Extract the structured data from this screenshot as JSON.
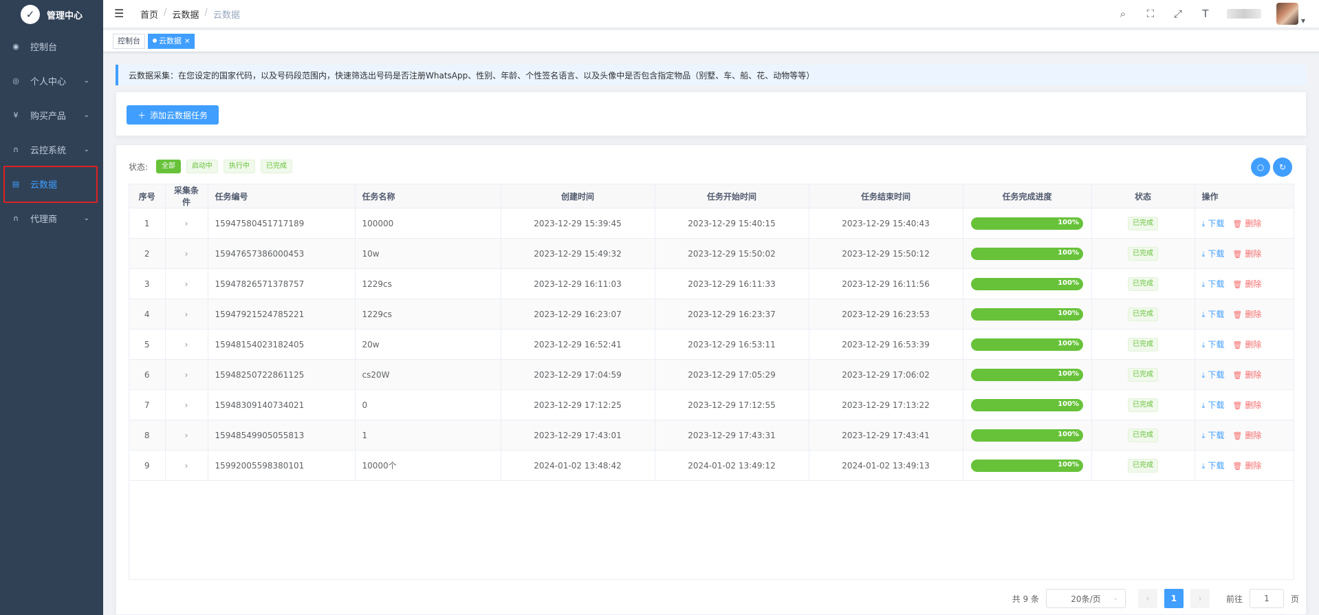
{
  "sidebar": {
    "logo_text": "管理中心",
    "items": [
      {
        "label": "控制台",
        "icon": "dashboard-icon",
        "glyph": "◉",
        "has_children": false,
        "active": false
      },
      {
        "label": "个人中心",
        "icon": "user-icon",
        "glyph": "◎",
        "has_children": true,
        "active": false
      },
      {
        "label": "购买产品",
        "icon": "yen-icon",
        "glyph": "¥",
        "has_children": true,
        "active": false
      },
      {
        "label": "云控系统",
        "icon": "headset-icon",
        "glyph": "∩",
        "has_children": true,
        "active": false
      },
      {
        "label": "云数据",
        "icon": "document-icon",
        "glyph": "▤",
        "has_children": false,
        "active": true
      },
      {
        "label": "代理商",
        "icon": "headset-icon",
        "glyph": "∩",
        "has_children": true,
        "active": false
      }
    ]
  },
  "header": {
    "breadcrumb": [
      "首页",
      "云数据",
      "云数据"
    ]
  },
  "tags": {
    "items": [
      {
        "label": "控制台",
        "active": false
      },
      {
        "label": "云数据",
        "active": true
      }
    ]
  },
  "alert": {
    "text": "云数据采集：在您设定的国家代码，以及号码段范围内，快速筛选出号码是否注册WhatsApp、性别、年龄、个性签名语言、以及头像中是否包含指定物品（别墅、车、船、花、动物等等）"
  },
  "toolbar": {
    "add_label": "添加云数据任务"
  },
  "filter": {
    "label": "状态:",
    "options": [
      "全部",
      "启动中",
      "执行中",
      "已完成"
    ],
    "selected": "全部"
  },
  "table": {
    "columns": [
      "序号",
      "采集条件",
      "任务编号",
      "任务名称",
      "创建时间",
      "任务开始时间",
      "任务结束时间",
      "任务完成进度",
      "状态",
      "操作"
    ],
    "download_label": "下载",
    "delete_label": "删除",
    "rows": [
      {
        "index": "1",
        "task_id": "15947580451717189",
        "name": "100000",
        "created": "2023-12-29 15:39:45",
        "start": "2023-12-29 15:40:15",
        "end": "2023-12-29 15:40:43",
        "progress": "100%",
        "status": "已完成"
      },
      {
        "index": "2",
        "task_id": "15947657386000453",
        "name": "10w",
        "created": "2023-12-29 15:49:32",
        "start": "2023-12-29 15:50:02",
        "end": "2023-12-29 15:50:12",
        "progress": "100%",
        "status": "已完成"
      },
      {
        "index": "3",
        "task_id": "15947826571378757",
        "name": "1229cs",
        "created": "2023-12-29 16:11:03",
        "start": "2023-12-29 16:11:33",
        "end": "2023-12-29 16:11:56",
        "progress": "100%",
        "status": "已完成"
      },
      {
        "index": "4",
        "task_id": "15947921524785221",
        "name": "1229cs",
        "created": "2023-12-29 16:23:07",
        "start": "2023-12-29 16:23:37",
        "end": "2023-12-29 16:23:53",
        "progress": "100%",
        "status": "已完成"
      },
      {
        "index": "5",
        "task_id": "15948154023182405",
        "name": "20w",
        "created": "2023-12-29 16:52:41",
        "start": "2023-12-29 16:53:11",
        "end": "2023-12-29 16:53:39",
        "progress": "100%",
        "status": "已完成"
      },
      {
        "index": "6",
        "task_id": "15948250722861125",
        "name": "cs20W",
        "created": "2023-12-29 17:04:59",
        "start": "2023-12-29 17:05:29",
        "end": "2023-12-29 17:06:02",
        "progress": "100%",
        "status": "已完成"
      },
      {
        "index": "7",
        "task_id": "15948309140734021",
        "name": "0",
        "created": "2023-12-29 17:12:25",
        "start": "2023-12-29 17:12:55",
        "end": "2023-12-29 17:13:22",
        "progress": "100%",
        "status": "已完成"
      },
      {
        "index": "8",
        "task_id": "15948549905055813",
        "name": "1",
        "created": "2023-12-29 17:43:01",
        "start": "2023-12-29 17:43:31",
        "end": "2023-12-29 17:43:41",
        "progress": "100%",
        "status": "已完成"
      },
      {
        "index": "9",
        "task_id": "15992005598380101",
        "name": "10000个",
        "created": "2024-01-02 13:48:42",
        "start": "2024-01-02 13:49:12",
        "end": "2024-01-02 13:49:13",
        "progress": "100%",
        "status": "已完成"
      }
    ]
  },
  "pagination": {
    "total_text": "共 9 条",
    "page_size": "20条/页",
    "current_page": "1",
    "goto_label": "前往",
    "goto_value": "1",
    "page_unit": "页"
  },
  "colors": {
    "primary": "#409eff",
    "success": "#67c23a",
    "danger": "#f56c6c",
    "sidebar_bg": "#304156"
  }
}
